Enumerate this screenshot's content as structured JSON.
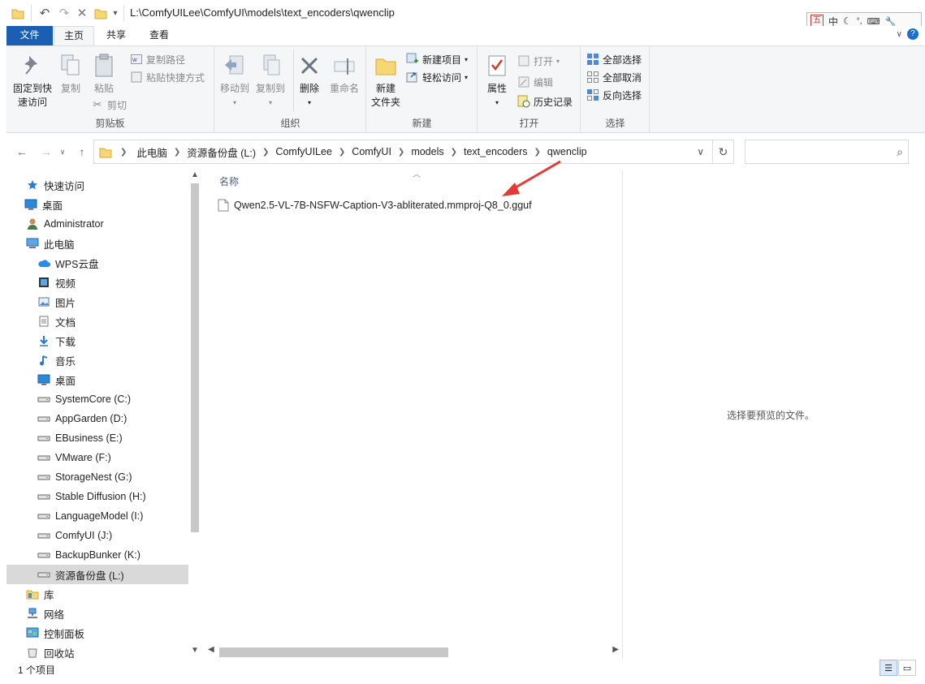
{
  "window": {
    "title_path": "L:\\ComfyUILee\\ComfyUI\\models\\text_encoders\\qwenclip"
  },
  "ime": {
    "mode_label": "中",
    "punct": "°,"
  },
  "tabs": [
    {
      "label": "文件"
    },
    {
      "label": "主页"
    },
    {
      "label": "共享"
    },
    {
      "label": "查看"
    }
  ],
  "ribbon": {
    "clipboard": {
      "group": "剪贴板",
      "pin_label_1": "固定到快",
      "pin_label_2": "速访问",
      "copy": "复制",
      "paste": "粘贴",
      "copy_path": "复制路径",
      "paste_shortcut": "粘贴快捷方式",
      "cut": "剪切"
    },
    "organize": {
      "group": "组织",
      "move_to": "移动到",
      "copy_to": "复制到",
      "delete": "删除",
      "rename": "重命名"
    },
    "new": {
      "group": "新建",
      "new_folder_1": "新建",
      "new_folder_2": "文件夹",
      "new_item": "新建项目",
      "easy_access": "轻松访问"
    },
    "open": {
      "group": "打开",
      "properties": "属性",
      "open": "打开",
      "edit": "编辑",
      "history": "历史记录"
    },
    "select": {
      "group": "选择",
      "select_all": "全部选择",
      "select_none": "全部取消",
      "invert": "反向选择"
    }
  },
  "address": {
    "crumbs": [
      "此电脑",
      "资源备份盘 (L:)",
      "ComfyUILee",
      "ComfyUI",
      "models",
      "text_encoders",
      "qwenclip"
    ]
  },
  "search": {
    "placeholder": ""
  },
  "nav": [
    {
      "label": "快速访问",
      "icon": "star-icon",
      "indent": 1
    },
    {
      "label": "桌面",
      "icon": "desktop-icon",
      "indent": 0
    },
    {
      "label": "Administrator",
      "icon": "user-icon",
      "indent": 1
    },
    {
      "label": "此电脑",
      "icon": "computer-icon",
      "indent": 1
    },
    {
      "label": "WPS云盘",
      "icon": "cloud-icon",
      "indent": 2
    },
    {
      "label": "视频",
      "icon": "video-icon",
      "indent": 2
    },
    {
      "label": "图片",
      "icon": "pictures-icon",
      "indent": 2
    },
    {
      "label": "文档",
      "icon": "documents-icon",
      "indent": 2
    },
    {
      "label": "下载",
      "icon": "download-icon",
      "indent": 2
    },
    {
      "label": "音乐",
      "icon": "music-icon",
      "indent": 2
    },
    {
      "label": "桌面",
      "icon": "desktop-icon",
      "indent": 2
    },
    {
      "label": "SystemCore (C:)",
      "icon": "drive-icon",
      "indent": 2
    },
    {
      "label": "AppGarden (D:)",
      "icon": "drive-icon",
      "indent": 2
    },
    {
      "label": "EBusiness (E:)",
      "icon": "drive-icon",
      "indent": 2
    },
    {
      "label": "VMware (F:)",
      "icon": "drive-icon",
      "indent": 2
    },
    {
      "label": "StorageNest (G:)",
      "icon": "drive-icon",
      "indent": 2
    },
    {
      "label": "Stable Diffusion (H:)",
      "icon": "drive-icon",
      "indent": 2
    },
    {
      "label": "LanguageModel (I:)",
      "icon": "drive-icon",
      "indent": 2
    },
    {
      "label": "ComfyUI (J:)",
      "icon": "drive-icon",
      "indent": 2
    },
    {
      "label": "BackupBunker (K:)",
      "icon": "drive-icon",
      "indent": 2
    },
    {
      "label": "资源备份盘 (L:)",
      "icon": "drive-icon",
      "indent": 2,
      "selected": true
    },
    {
      "label": "库",
      "icon": "library-icon",
      "indent": 1
    },
    {
      "label": "网络",
      "icon": "network-icon",
      "indent": 1
    },
    {
      "label": "控制面板",
      "icon": "control-panel-icon",
      "indent": 1
    },
    {
      "label": "回收站",
      "icon": "recycle-bin-icon",
      "indent": 1
    }
  ],
  "filelist": {
    "column_name": "名称",
    "files": [
      {
        "name": "Qwen2.5-VL-7B-NSFW-Caption-V3-abliterated.mmproj-Q8_0.gguf",
        "icon": "file-icon"
      }
    ]
  },
  "preview": {
    "text": "选择要预览的文件。"
  },
  "status": {
    "count": "1 个项目"
  },
  "colors": {
    "accent": "#1a5fb4",
    "arrow": "#e53935"
  }
}
